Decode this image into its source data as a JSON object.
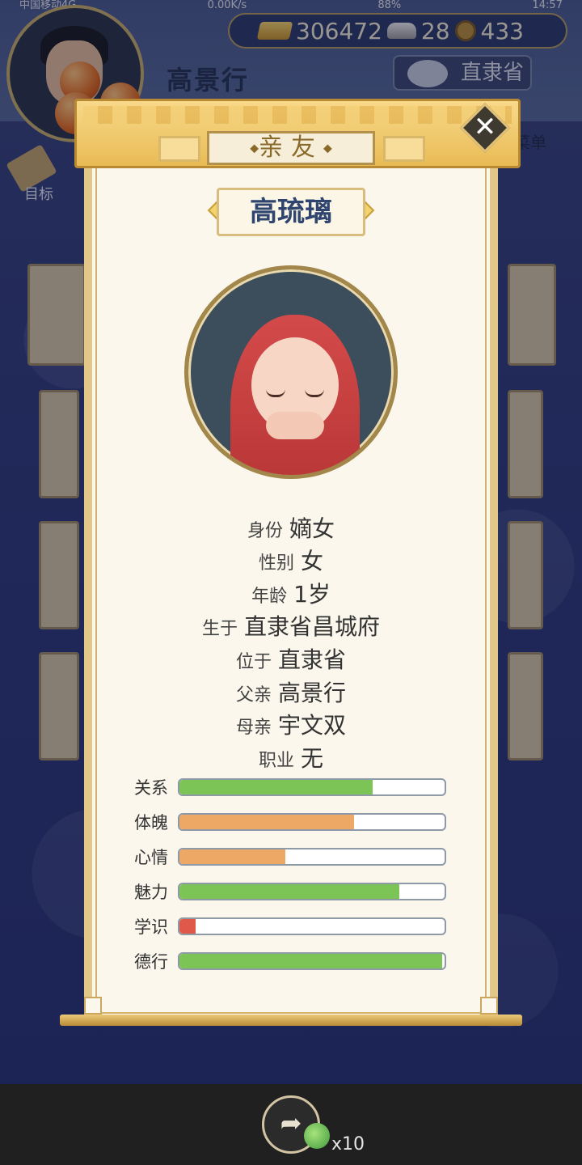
{
  "status_bar": {
    "carrier": "中国移动4G",
    "speed": "0.00K/s",
    "battery": "88%",
    "time": "14:57"
  },
  "player": {
    "name": "高景行"
  },
  "currency": {
    "gold": "306472",
    "silver": "28",
    "coin": "433"
  },
  "location_button": "直隶省",
  "menu_label": "菜单",
  "target_label": "目标",
  "dialog": {
    "title": "亲友",
    "name": "高琉璃",
    "info": [
      {
        "label": "身份",
        "value": "嫡女"
      },
      {
        "label": "性别",
        "value": "女"
      },
      {
        "label": "年龄",
        "value": "1岁"
      },
      {
        "label": "生于",
        "value": "直隶省昌城府"
      },
      {
        "label": "位于",
        "value": "直隶省"
      },
      {
        "label": "父亲",
        "value": "高景行"
      },
      {
        "label": "母亲",
        "value": "宇文双"
      },
      {
        "label": "职业",
        "value": "无"
      }
    ],
    "stats": [
      {
        "label": "关系",
        "value": 0.73,
        "color": "#7cc456"
      },
      {
        "label": "体魄",
        "value": 0.66,
        "color": "#eda866"
      },
      {
        "label": "心情",
        "value": 0.4,
        "color": "#eda866"
      },
      {
        "label": "魅力",
        "value": 0.83,
        "color": "#7cc456"
      },
      {
        "label": "学识",
        "value": 0.06,
        "color": "#e0584a"
      },
      {
        "label": "德行",
        "value": 0.99,
        "color": "#7cc456"
      }
    ]
  },
  "bottom": {
    "share_count": "x10"
  },
  "icons": [
    "gold-ingot-icon",
    "silver-ingot-icon",
    "coin-icon",
    "location-icon",
    "close-icon",
    "share-icon",
    "gift-icon"
  ]
}
